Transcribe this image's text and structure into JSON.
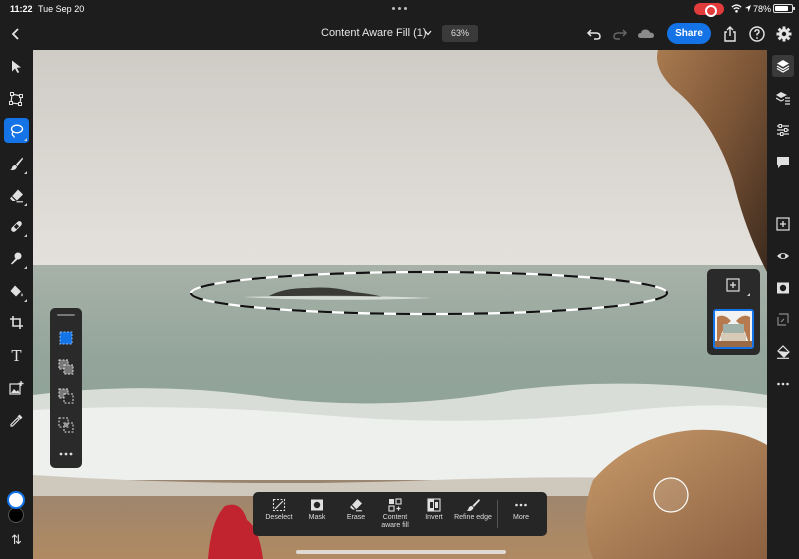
{
  "status_bar": {
    "time": "11:22",
    "date": "Tue Sep 20",
    "battery_percent": "78%"
  },
  "header": {
    "title": "Content Aware Fill (1)",
    "zoom": "63%",
    "share_label": "Share"
  },
  "left_toolbar": {
    "tools": [
      "select-arrow-icon",
      "transform-icon",
      "lasso-icon",
      "brush-icon",
      "eraser-icon",
      "healing-icon",
      "clone-stamp-icon",
      "paint-bucket-icon",
      "crop-icon",
      "type-tool",
      "place-image-icon",
      "eyedropper-icon",
      "swap-colors-icon"
    ],
    "active_tool": "lasso-icon",
    "type_glyph": "T",
    "swap_glyph": "⇅",
    "foreground_color": "#ffffff",
    "background_color": "#000000"
  },
  "selection_modes": [
    "new-selection-icon",
    "add-selection-icon",
    "subtract-selection-icon",
    "intersect-selection-icon",
    "more-icon"
  ],
  "right_toolbar": {
    "tools": [
      "layers-icon",
      "layer-properties-icon",
      "adjustments-icon",
      "comments-icon",
      "add-layer-icon",
      "visibility-icon",
      "layer-mask-icon",
      "clip-icon",
      "fill-icon",
      "more-icon"
    ]
  },
  "task_bar": {
    "items": [
      {
        "icon": "deselect-icon",
        "label": "Deselect"
      },
      {
        "icon": "mask-icon",
        "label": "Mask"
      },
      {
        "icon": "erase-icon",
        "label": "Erase"
      },
      {
        "icon": "content-aware-fill-icon",
        "label": "Content aware fill"
      },
      {
        "icon": "invert-icon",
        "label": "Invert"
      },
      {
        "icon": "refine-edge-icon",
        "label": "Refine edge"
      },
      {
        "icon": "more-icon",
        "label": "More"
      }
    ]
  },
  "colors": {
    "accent": "#1473e6",
    "chrome": "#1d1d1d",
    "panel": "#2a2a2a"
  }
}
